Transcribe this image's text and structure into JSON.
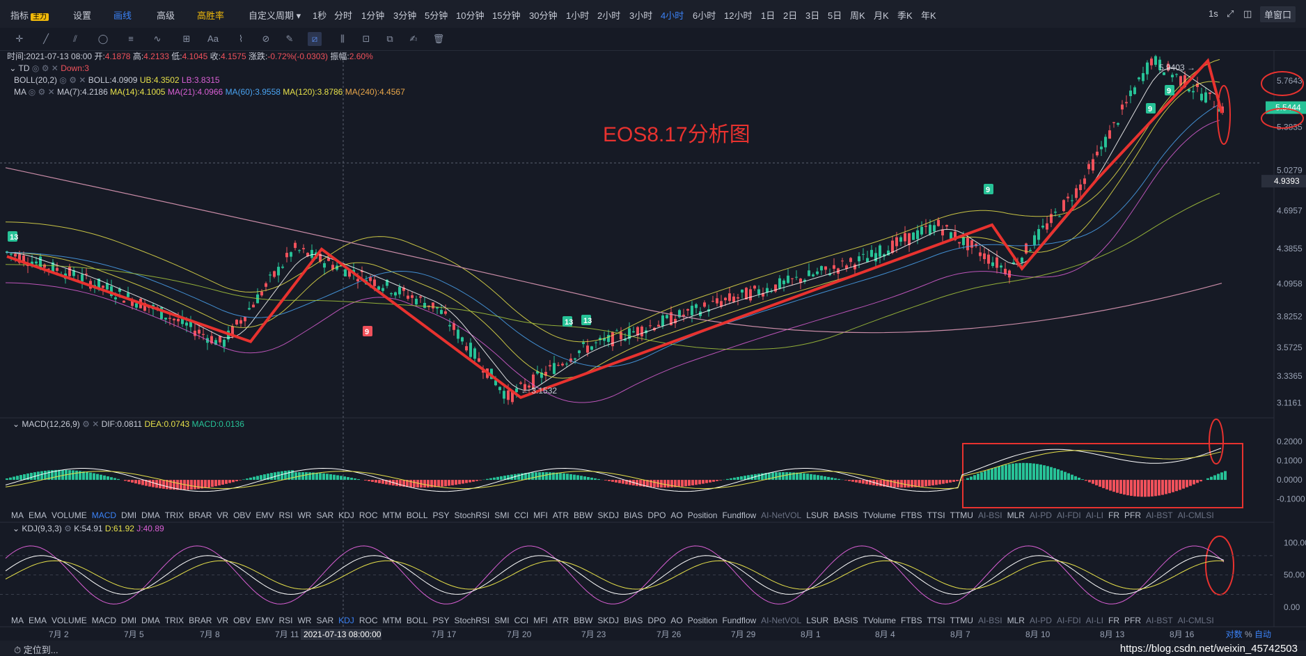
{
  "topbar": {
    "items": [
      {
        "label": "指标",
        "badge": "主力",
        "x": 15
      },
      {
        "label": "设置",
        "x": 105
      },
      {
        "label": "画线",
        "x": 163,
        "active": true
      },
      {
        "label": "高级",
        "x": 225
      },
      {
        "label": "高胜率",
        "x": 283,
        "yellow": true
      },
      {
        "label": "自定义周期 ▾",
        "x": 357
      },
      {
        "label": "1秒",
        "x": 449
      },
      {
        "label": "分时",
        "x": 480
      },
      {
        "label": "1分钟",
        "x": 519
      },
      {
        "label": "3分钟",
        "x": 565
      },
      {
        "label": "5分钟",
        "x": 610
      },
      {
        "label": "10分钟",
        "x": 655
      },
      {
        "label": "15分钟",
        "x": 707
      },
      {
        "label": "30分钟",
        "x": 760
      },
      {
        "label": "1小时",
        "x": 813
      },
      {
        "label": "2小时",
        "x": 858
      },
      {
        "label": "3小时",
        "x": 904
      },
      {
        "label": "4小时",
        "x": 949,
        "active": true
      },
      {
        "label": "6小时",
        "x": 995
      },
      {
        "label": "12小时",
        "x": 1040
      },
      {
        "label": "1日",
        "x": 1093
      },
      {
        "label": "2日",
        "x": 1125
      },
      {
        "label": "3日",
        "x": 1157
      },
      {
        "label": "5日",
        "x": 1189
      },
      {
        "label": "周K",
        "x": 1221
      },
      {
        "label": "月K",
        "x": 1255
      },
      {
        "label": "季K",
        "x": 1289
      },
      {
        "label": "年K",
        "x": 1323
      }
    ],
    "right_time": "1s",
    "window_select": "单窗口"
  },
  "legend": {
    "time_label": "时间:",
    "time": "2021-07-13 08:00",
    "open_label": "开:",
    "open": "4.1878",
    "high_label": "高:",
    "high": "4.2133",
    "low_label": "低:",
    "low": "4.1045",
    "close_label": "收:",
    "close": "4.1575",
    "change_label": "涨跌:",
    "change": "-0.72%(-0.0303)",
    "amp_label": "振幅:",
    "amp": "2.60%",
    "td": "TD",
    "td_down": "Down:3",
    "boll_name": "BOLL(20,2)",
    "boll_mid": "BOLL:4.0909",
    "boll_ub": "UB:4.3502",
    "boll_lb": "LB:3.8315",
    "ma_name": "MA",
    "ma7": "MA(7):4.2186",
    "ma14": "MA(14):4.1005",
    "ma21": "MA(21):4.0966",
    "ma60": "MA(60):3.9558",
    "ma120": "MA(120):3.8786",
    "ma240": "MA(240):4.4567"
  },
  "annotation_title": "EOS8.17分析图",
  "price_axis": [
    "5.7643",
    "5.5444",
    "5.3835",
    "5.0279",
    "4.9393",
    "4.6957",
    "4.3855",
    "4.0958",
    "3.8252",
    "3.5725",
    "3.3365",
    "3.1161"
  ],
  "markers": {
    "high": "5.9403",
    "low": "3.1532"
  },
  "td_counts": [
    "13",
    "9",
    "9",
    "13",
    "9",
    "9",
    "13"
  ],
  "macd": {
    "name": "MACD(12,26,9)",
    "dif": "DIF:0.0811",
    "dea": "DEA:0.0743",
    "macd": "MACD:0.0136",
    "axis": [
      "0.2000",
      "0.1000",
      "0.0000",
      "-0.1000"
    ]
  },
  "kdj": {
    "name": "KDJ(9,3,3)",
    "k": "K:54.91",
    "d": "D:61.92",
    "j": "J:40.89",
    "axis": [
      "100.00",
      "50.00",
      "0.00"
    ]
  },
  "indicator_tabs": [
    "MA",
    "EMA",
    "VOLUME",
    "MACD",
    "DMI",
    "DMA",
    "TRIX",
    "BRAR",
    "VR",
    "OBV",
    "EMV",
    "RSI",
    "WR",
    "SAR",
    "KDJ",
    "ROC",
    "MTM",
    "BOLL",
    "PSY",
    "StochRSI",
    "SMI",
    "CCI",
    "MFI",
    "ATR",
    "BBW",
    "SKDJ",
    "BIAS",
    "DPO",
    "AO",
    "Position",
    "Fundflow",
    "AI-NetVOL",
    "LSUR",
    "BASIS",
    "TVolume",
    "FTBS",
    "TTSI",
    "TTMU",
    "AI-BSI",
    "MLR",
    "AI-PD",
    "AI-FDI",
    "AI-LI",
    "FR",
    "PFR",
    "AI-BST",
    "AI-CMLSI"
  ],
  "xaxis": [
    "7月 2",
    "7月 5",
    "7月 8",
    "7月 11",
    "2021-07-13 08:00:00",
    "7月 17",
    "7月 20",
    "7月 23",
    "7月 26",
    "7月 29",
    "8月 1",
    "8月 4",
    "8月 7",
    "8月 10",
    "8月 13",
    "8月 16"
  ],
  "bottombar": {
    "locate": "定位到...",
    "watermark": "https://blog.csdn.net/weixin_45742503",
    "right1": "对数",
    "right2": "%",
    "right3": "自动"
  },
  "chart_data": {
    "type": "line",
    "title": "EOS8.17分析图",
    "ylabel": "",
    "ylim": [
      3.05,
      6.0
    ],
    "x": [
      "7月2",
      "7月5",
      "7月8",
      "7月11",
      "7月13",
      "7月17",
      "7月20",
      "7月23",
      "7月26",
      "7月29",
      "8月1",
      "8月4",
      "8月7",
      "8月10",
      "8月13",
      "8月16",
      "8月17"
    ],
    "series": [
      {
        "values": [
          4.35,
          4.15,
          3.9,
          3.6,
          4.38,
          4.15,
          3.9,
          3.16,
          3.55,
          3.75,
          3.95,
          4.12,
          4.3,
          4.58,
          4.2,
          4.9,
          5.94,
          5.54
        ]
      }
    ]
  }
}
